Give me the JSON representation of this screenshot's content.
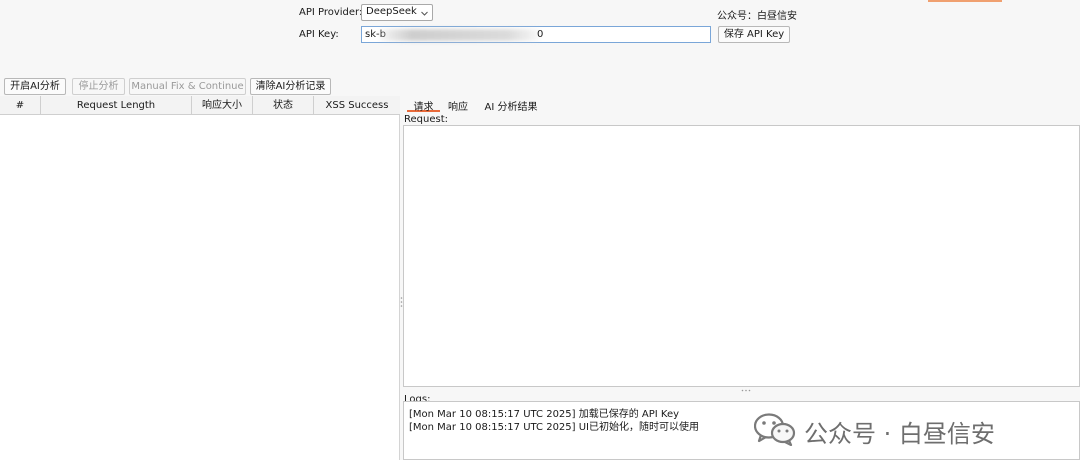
{
  "config": {
    "provider_label": "API Provider:",
    "provider_value": "DeepSeek",
    "key_label": "API Key:",
    "key_visible_start": "sk-b",
    "key_visible_end": "0",
    "save_key_label": "保存 API Key",
    "account_text": "公众号：白昼信安"
  },
  "toolbar": {
    "start_label": "开启AI分析",
    "stop_label": "停止分析",
    "manual_fix_label": "Manual Fix & Continue",
    "clear_label": "清除AI分析记录"
  },
  "table": {
    "columns": [
      "#",
      "Request Length",
      "响应大小",
      "状态",
      "XSS Success"
    ],
    "rows": []
  },
  "tabs": {
    "request": "请求",
    "response": "响应",
    "ai_result": "AI 分析结果",
    "active": "请求"
  },
  "request_panel": {
    "label": "Request:"
  },
  "logs": {
    "label": "Logs:",
    "lines": [
      "[Mon Mar 10 08:15:17 UTC 2025] 加载已保存的 API Key",
      "[Mon Mar 10 08:15:17 UTC 2025] UI已初始化，随时可以使用"
    ]
  },
  "watermark": {
    "text": "公众号 · 白昼信安"
  },
  "colors": {
    "active_tab": "#e86a3a",
    "input_focus_border": "#7aa6d8"
  }
}
